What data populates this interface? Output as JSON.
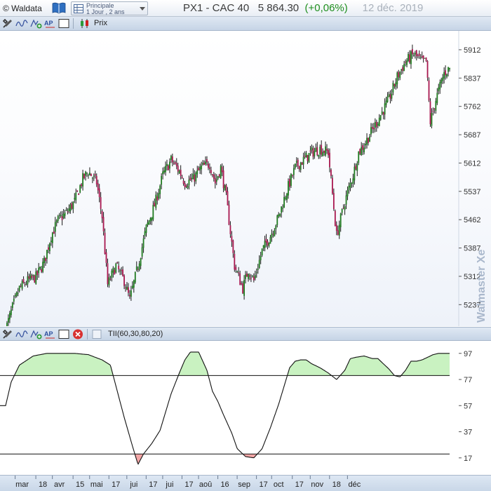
{
  "titlebar": {
    "copyright": "© Waldata",
    "selector_name": "Principale",
    "selector_period": "1 Jour , 2 ans",
    "instrument": "PX1 - CAC 40",
    "price": "5 864.30",
    "change": "(+0,06%)",
    "date": "12 déc. 2019"
  },
  "toolbar_top": {
    "series_label": "Prix"
  },
  "toolbar_bottom": {
    "indicator_label": "TII(60,30,80,20)"
  },
  "brand": "Walmaster Xe",
  "colors": {
    "up": "#1f7a1f",
    "down": "#a8174f",
    "wick": "#1a1a1a",
    "overbought_fill": "#c9f2c1",
    "oversold_fill": "#f3a6a6",
    "accent": "#1f8f1f"
  },
  "chart_data": [
    {
      "type": "candlestick",
      "title": "PX1 - CAC 40",
      "y_ticks": [
        5912,
        5837,
        5762,
        5687,
        5612,
        5537,
        5462,
        5387,
        5312,
        5237
      ],
      "ylim": [
        5180,
        5962
      ],
      "x_labels": [
        "mar",
        "18",
        "avr",
        "15",
        "mai",
        "17",
        "jui",
        "17",
        "jui",
        "17",
        "aoû",
        "16",
        "sep",
        "17",
        "oct",
        "17",
        "nov",
        "18",
        "déc"
      ],
      "close_path_days": [
        0,
        5,
        10,
        16,
        22,
        28,
        33,
        38,
        44,
        50,
        56,
        60,
        66,
        70,
        74,
        80,
        86,
        90,
        96,
        102,
        108,
        114,
        120,
        126,
        130,
        136,
        142,
        148,
        152,
        156,
        160,
        166,
        172,
        176,
        180,
        186,
        192,
        198,
        204,
        210,
        216,
        222,
        228,
        234,
        240,
        246,
        252,
        256,
        260,
        266,
        272,
        278,
        284,
        290,
        296,
        302,
        305,
        308,
        312,
        318,
        322
      ],
      "close_path_values": [
        5170,
        5230,
        5280,
        5300,
        5310,
        5350,
        5420,
        5460,
        5480,
        5510,
        5570,
        5590,
        5560,
        5470,
        5290,
        5340,
        5300,
        5250,
        5340,
        5440,
        5500,
        5580,
        5620,
        5590,
        5560,
        5570,
        5600,
        5610,
        5560,
        5600,
        5520,
        5340,
        5280,
        5330,
        5300,
        5380,
        5420,
        5470,
        5540,
        5600,
        5620,
        5640,
        5650,
        5640,
        5420,
        5510,
        5580,
        5640,
        5660,
        5700,
        5740,
        5780,
        5840,
        5880,
        5900,
        5880,
        5880,
        5720,
        5780,
        5850,
        5864
      ]
    },
    {
      "type": "line",
      "title": "TII(60,30,80,20)",
      "y_ticks": [
        97,
        77,
        57,
        37,
        17
      ],
      "ylim": [
        4,
        106
      ],
      "thresholds": [
        80,
        20
      ],
      "days": [
        0,
        4,
        10,
        20,
        30,
        40,
        50,
        60,
        70,
        76,
        80,
        86,
        92,
        96,
        100,
        106,
        112,
        116,
        120,
        126,
        130,
        134,
        140,
        146,
        150,
        154,
        158,
        164,
        168,
        174,
        180,
        186,
        192,
        198,
        202,
        206,
        210,
        214,
        218,
        222,
        228,
        234,
        240,
        246,
        250,
        254,
        260,
        266,
        270,
        274,
        278,
        282,
        286,
        290,
        294,
        298,
        302,
        306,
        310,
        314,
        322
      ],
      "values": [
        57,
        75,
        88,
        95,
        97,
        97,
        97,
        96,
        92,
        88,
        72,
        48,
        26,
        12,
        20,
        28,
        38,
        52,
        66,
        82,
        92,
        98,
        98,
        84,
        68,
        60,
        50,
        36,
        24,
        18,
        17,
        24,
        40,
        58,
        72,
        86,
        91,
        92,
        92,
        89,
        86,
        82,
        77,
        84,
        93,
        94,
        95,
        93,
        93,
        89,
        85,
        80,
        79,
        84,
        91,
        91,
        92,
        94,
        96,
        97,
        97
      ]
    }
  ]
}
